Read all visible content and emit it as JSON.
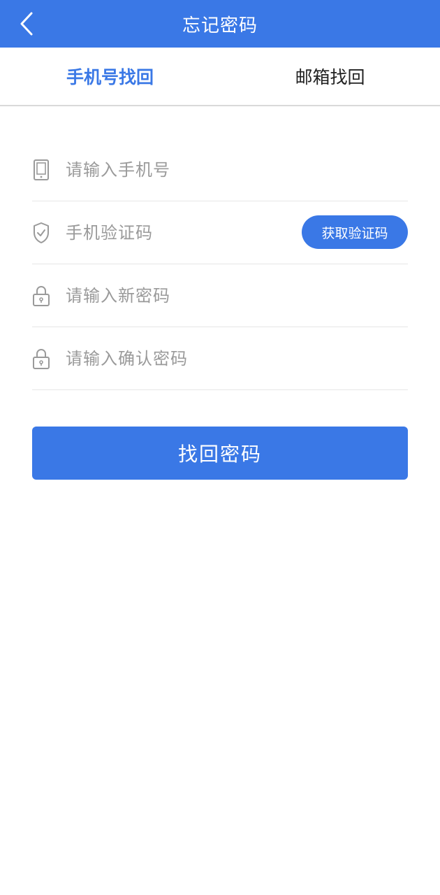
{
  "header": {
    "title": "忘记密码",
    "back_icon": "chevron-left-icon"
  },
  "tabs": [
    {
      "label": "手机号找回",
      "active": true
    },
    {
      "label": "邮箱找回",
      "active": false
    }
  ],
  "form": {
    "phone": {
      "placeholder": "请输入手机号",
      "value": "",
      "icon": "phone-icon"
    },
    "code": {
      "placeholder": "手机验证码",
      "value": "",
      "icon": "shield-check-icon",
      "button_label": "获取验证码"
    },
    "new_password": {
      "placeholder": "请输入新密码",
      "value": "",
      "icon": "lock-icon"
    },
    "confirm_password": {
      "placeholder": "请输入确认密码",
      "value": "",
      "icon": "lock-icon"
    }
  },
  "submit_label": "找回密码",
  "colors": {
    "accent": "#3a78e6",
    "placeholder": "#9a9a9a",
    "divider": "#e6e6e6",
    "icon": "#9a9a9a"
  }
}
